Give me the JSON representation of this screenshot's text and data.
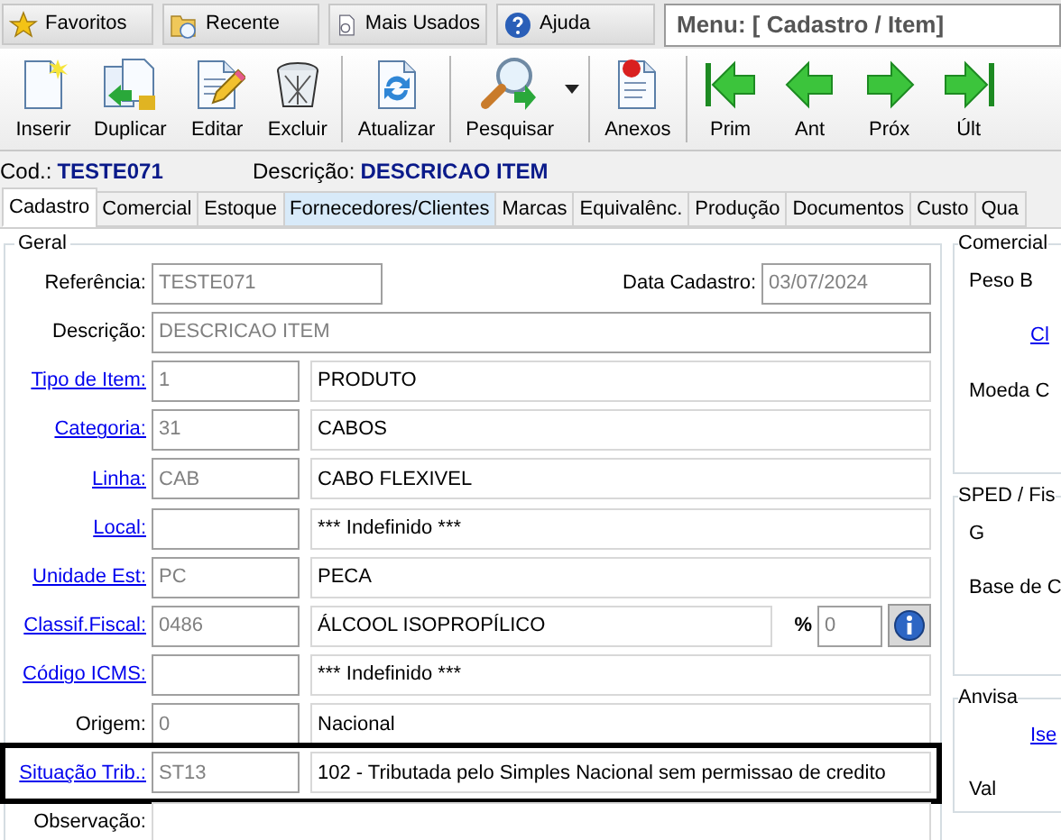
{
  "top_bar": {
    "buttons": [
      {
        "label": "Favoritos"
      },
      {
        "label": "Recente"
      },
      {
        "label": "Mais Usados"
      },
      {
        "label": "Ajuda"
      }
    ],
    "menu_field": "Menu: [ Cadastro / Item]"
  },
  "toolbar": [
    {
      "label": "Inserir",
      "group_end": false,
      "dropdown": false
    },
    {
      "label": "Duplicar",
      "group_end": false,
      "dropdown": false
    },
    {
      "label": "Editar",
      "group_end": false,
      "dropdown": false
    },
    {
      "label": "Excluir",
      "group_end": true,
      "dropdown": false
    },
    {
      "label": "Atualizar",
      "group_end": true,
      "dropdown": false
    },
    {
      "label": "Pesquisar",
      "group_end": true,
      "dropdown": true
    },
    {
      "label": "Anexos",
      "group_end": true,
      "dropdown": false
    },
    {
      "label": "Prim",
      "group_end": false,
      "dropdown": false
    },
    {
      "label": "Ant",
      "group_end": false,
      "dropdown": false
    },
    {
      "label": "Próx",
      "group_end": false,
      "dropdown": false
    },
    {
      "label": "Últ",
      "group_end": false,
      "dropdown": false
    }
  ],
  "header": [
    {
      "label": "Cod.:",
      "value": "TESTE071"
    },
    {
      "label": "Descrição:",
      "value": "DESCRICAO ITEM"
    }
  ],
  "tabs": [
    {
      "label": "Cadastro",
      "selected": true,
      "hovered": false
    },
    {
      "label": "Comercial",
      "selected": false,
      "hovered": false
    },
    {
      "label": "Estoque",
      "selected": false,
      "hovered": false
    },
    {
      "label": "Fornecedores/Clientes",
      "selected": false,
      "hovered": true
    },
    {
      "label": "Marcas",
      "selected": false,
      "hovered": false
    },
    {
      "label": "Equivalênc.",
      "selected": false,
      "hovered": false
    },
    {
      "label": "Produção",
      "selected": false,
      "hovered": false
    },
    {
      "label": "Documentos",
      "selected": false,
      "hovered": false
    },
    {
      "label": "Custo",
      "selected": false,
      "hovered": false
    },
    {
      "label": "Qua",
      "selected": false,
      "hovered": false
    }
  ],
  "geral": {
    "title": "Geral",
    "rows": [
      {
        "kind": "ref",
        "label": "Referência:",
        "link": false,
        "highlighted": false,
        "value": "TESTE071",
        "date_label": "Data Cadastro:",
        "date": "03/07/2024"
      },
      {
        "kind": "wide",
        "label": "Descrição:",
        "link": false,
        "highlighted": false,
        "value": "DESCRICAO ITEM"
      },
      {
        "kind": "pair",
        "label": "Tipo de Item:",
        "link": true,
        "highlighted": false,
        "code": "1",
        "text": "PRODUTO"
      },
      {
        "kind": "pair",
        "label": "Categoria:",
        "link": true,
        "highlighted": false,
        "code": "31",
        "text": "CABOS"
      },
      {
        "kind": "pair",
        "label": "Linha:",
        "link": true,
        "highlighted": false,
        "code": "CAB",
        "text": "CABO FLEXIVEL"
      },
      {
        "kind": "pair",
        "label": "Local:",
        "link": true,
        "highlighted": false,
        "text": "*** Indefinido ***"
      },
      {
        "kind": "pair",
        "label": "Unidade Est:",
        "link": true,
        "highlighted": false,
        "code": "PC",
        "text": "PECA"
      },
      {
        "kind": "pct",
        "label": "Classif.Fiscal:",
        "link": true,
        "highlighted": false,
        "code": "0486",
        "text": "ÁLCOOL ISOPROPÍLICO",
        "pct_label": "%",
        "pct": "0"
      },
      {
        "kind": "pair",
        "label": "Código ICMS:",
        "link": true,
        "highlighted": false,
        "text": "*** Indefinido ***"
      },
      {
        "kind": "pair",
        "label": "Origem:",
        "link": false,
        "highlighted": false,
        "code": "0",
        "text": "Nacional"
      },
      {
        "kind": "pair",
        "label": "Situação Trib.:",
        "link": true,
        "highlighted": true,
        "code": "ST13",
        "text": "102 - Tributada pelo Simples Nacional sem permissao de credito"
      },
      {
        "kind": "memo",
        "label": "Observação:",
        "link": false,
        "highlighted": false
      }
    ]
  },
  "side_panel": [
    {
      "title": "Comercial",
      "labels": [
        {
          "text": "Peso B",
          "link": false
        },
        {
          "text": "Cl",
          "link": true
        },
        {
          "text": "Moeda C",
          "link": false
        }
      ]
    },
    {
      "title": "SPED / Fis",
      "labels": [
        {
          "text": "G",
          "link": false
        },
        {
          "text": "Base de C",
          "link": false
        }
      ]
    },
    {
      "title": "Anvisa",
      "labels": [
        {
          "text": "Ise",
          "link": true
        },
        {
          "text": "Val",
          "link": false
        }
      ]
    }
  ]
}
